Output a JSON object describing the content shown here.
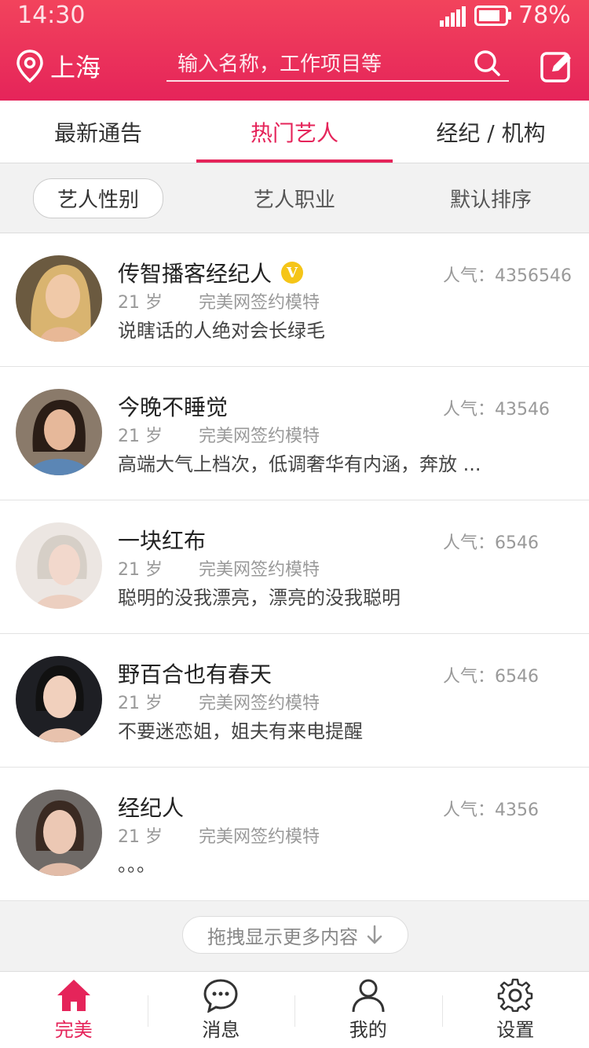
{
  "status_bar": {
    "time": "14:30",
    "battery": "78%"
  },
  "header": {
    "city": "上海",
    "search_placeholder": "输入名称，工作项目等"
  },
  "tabs": [
    {
      "label": "最新通告",
      "active": false
    },
    {
      "label": "热门艺人",
      "active": true
    },
    {
      "label": "经纪 / 机构",
      "active": false
    }
  ],
  "filters": [
    {
      "label": "艺人性别",
      "active": true
    },
    {
      "label": "艺人职业",
      "active": false
    },
    {
      "label": "默认排序",
      "active": false
    }
  ],
  "artists": [
    {
      "name": "传智播客经纪人",
      "verified": true,
      "verified_mark": "V",
      "popularity": "人气：4356546",
      "age": "21 岁",
      "company": "完美网签约模特",
      "desc": "说瞎话的人绝对会长绿毛"
    },
    {
      "name": "今晚不睡觉",
      "verified": false,
      "popularity": "人气：43546",
      "age": "21 岁",
      "company": "完美网签约模特",
      "desc": "高端大气上档次，低调奢华有内涵，奔放 ..."
    },
    {
      "name": "一块红布",
      "verified": false,
      "popularity": "人气：6546",
      "age": "21 岁",
      "company": "完美网签约模特",
      "desc": "聪明的没我漂亮，漂亮的没我聪明"
    },
    {
      "name": "野百合也有春天",
      "verified": false,
      "popularity": "人气：6546",
      "age": "21 岁",
      "company": "完美网签约模特",
      "desc": "不要迷恋姐，姐夫有来电提醒"
    },
    {
      "name": "经纪人",
      "verified": false,
      "popularity": "人气：4356",
      "age": "21 岁",
      "company": "完美网签约模特",
      "desc": "。。。"
    }
  ],
  "load_more": "拖拽显示更多内容",
  "bottom_nav": [
    {
      "label": "完美",
      "icon": "home-icon",
      "active": true
    },
    {
      "label": "消息",
      "icon": "message-icon",
      "active": false
    },
    {
      "label": "我的",
      "icon": "profile-icon",
      "active": false
    },
    {
      "label": "设置",
      "icon": "settings-icon",
      "active": false
    }
  ],
  "colors": {
    "accent": "#e5245a",
    "header_top": "#f2435c",
    "vip": "#f5c518"
  }
}
